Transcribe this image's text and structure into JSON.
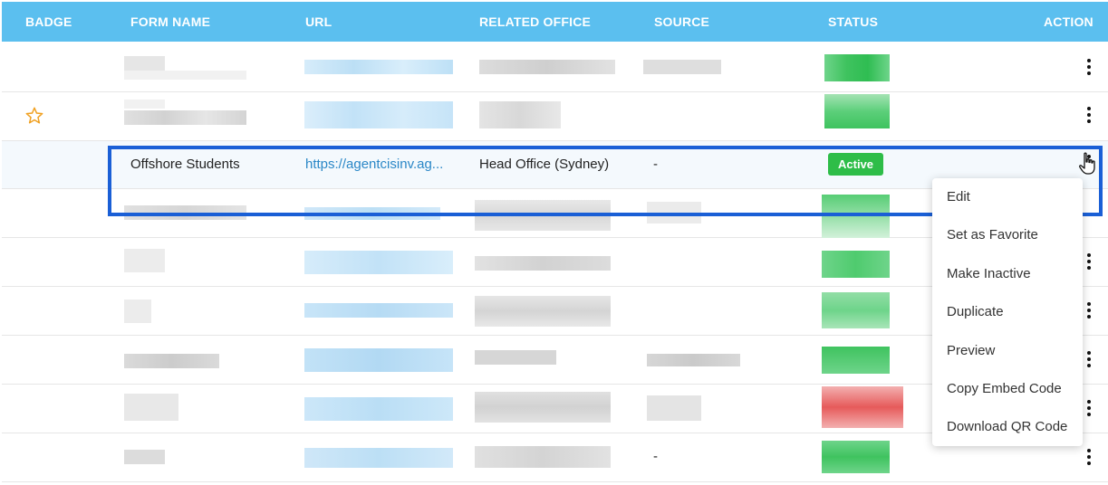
{
  "header": {
    "columns": [
      "BADGE",
      "FORM NAME",
      "URL",
      "RELATED OFFICE",
      "SOURCE",
      "STATUS",
      "ACTION"
    ]
  },
  "highlighted_row": {
    "form_name": "Offshore Students",
    "url": "https://agentcisinv.ag...",
    "related_office": "Head Office (Sydney)",
    "source": "-",
    "status": "Active"
  },
  "last_row": {
    "source": "-"
  },
  "action_menu": {
    "items": [
      "Edit",
      "Set as Favorite",
      "Make Inactive",
      "Duplicate",
      "Preview",
      "Copy Embed Code",
      "Download QR Code"
    ]
  },
  "icons": {
    "favorite": "star-icon",
    "action": "kebab-icon",
    "cursor": "hand-pointer-icon"
  },
  "colors": {
    "header_bg": "#5bbfef",
    "active_badge": "#2ebd48",
    "inactive_status": "#e05050",
    "link": "#2a87c7",
    "selection_outline": "#1a5fd6",
    "star": "#f0a020"
  }
}
